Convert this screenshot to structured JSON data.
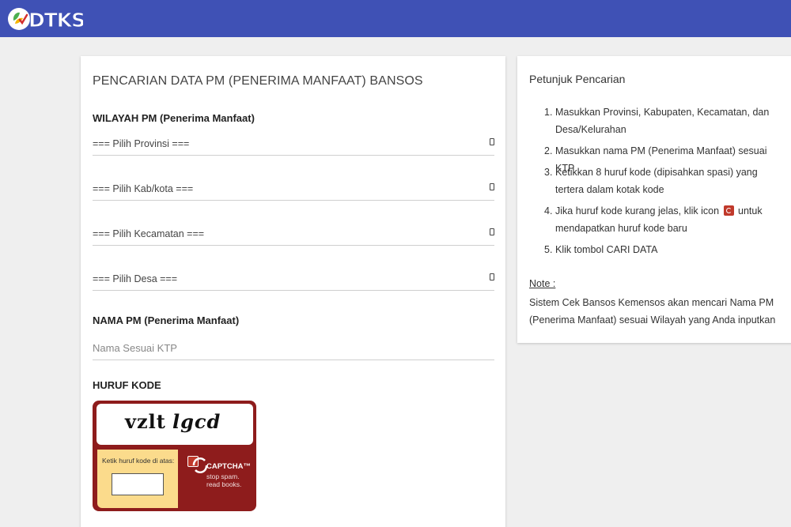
{
  "header": {
    "logo_text": "DTKS",
    "colors": {
      "bar": "#3f51b5"
    }
  },
  "form": {
    "title": "PENCARIAN DATA PM (PENERIMA MANFAAT) BANSOS",
    "region_label": "WILAYAH PM (Penerima Manfaat)",
    "selects": [
      {
        "value": "=== Pilih Provinsi ==="
      },
      {
        "value": "=== Pilih Kab/kota ==="
      },
      {
        "value": "=== Pilih Kecamatan ==="
      },
      {
        "value": "=== Pilih Desa ==="
      }
    ],
    "name_label": "NAMA PM (Penerima Manfaat)",
    "name_placeholder": "Nama Sesuai KTP",
    "code_label": "HURUF KODE",
    "captcha": {
      "words": [
        "vzlt",
        "lgcd"
      ],
      "prompt": "Ketik huruf kode di atas:",
      "brand": "CAPTCHA™",
      "slogan_1": "stop spam.",
      "slogan_2": "read books."
    }
  },
  "hints": {
    "title": "Petunjuk Pencarian",
    "items": [
      {
        "num": "1.",
        "text": "Masukkan Provinsi, Kabupaten, Kecamatan, dan Desa/Kelurahan"
      },
      {
        "num": "2.",
        "text": "Masukkan nama PM (Penerima Manfaat) sesuai KTP"
      },
      {
        "num": "3.",
        "text": "Ketikkan 8 huruf kode (dipisahkan spasi) yang tertera dalam kotak kode"
      },
      {
        "num": "4.",
        "text_before": "Jika huruf kode kurang jelas, klik icon",
        "text_after": "untuk mendapatkan huruf kode baru"
      },
      {
        "num": "5.",
        "text": "Klik tombol CARI DATA"
      }
    ],
    "note_label": "Note :",
    "note_text": "Sistem Cek Bansos Kemensos akan mencari Nama PM (Penerima Manfaat) sesuai Wilayah yang Anda inputkan"
  }
}
